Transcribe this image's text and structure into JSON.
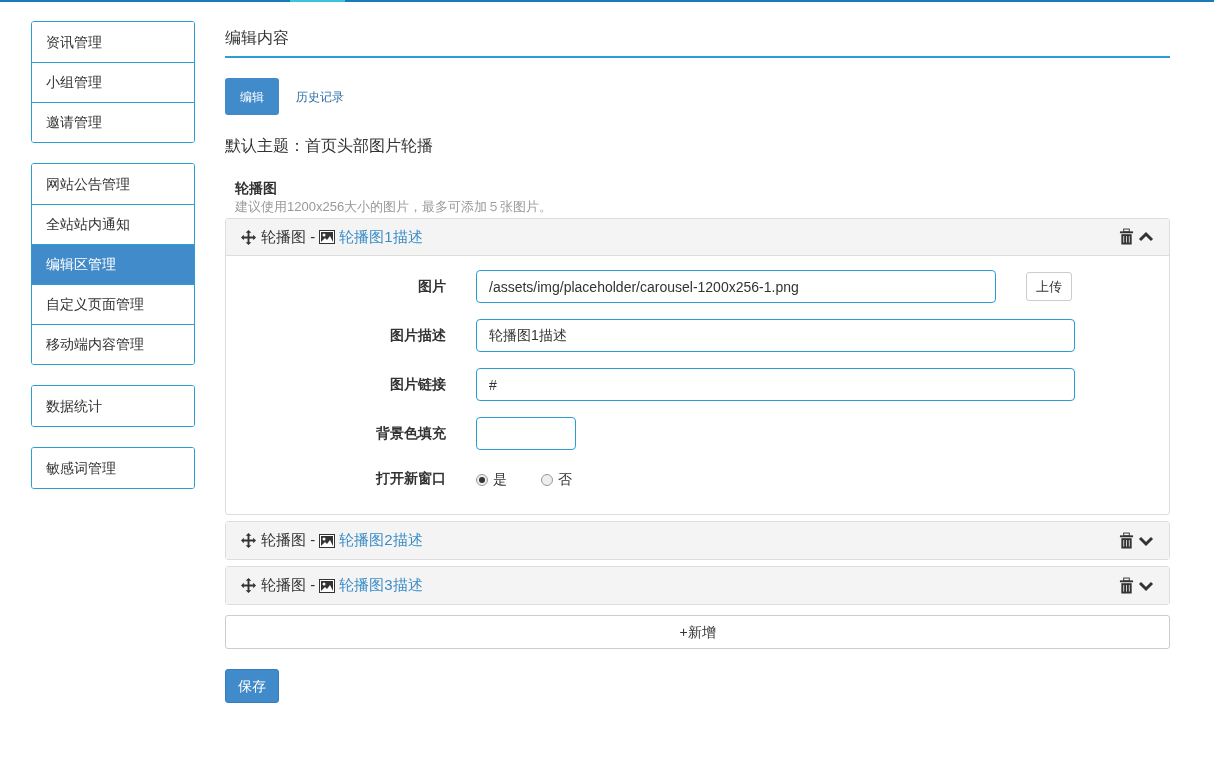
{
  "sidebar": {
    "groups": [
      [
        {
          "label": "资讯管理",
          "selected": false
        },
        {
          "label": "小组管理",
          "selected": false
        },
        {
          "label": "邀请管理",
          "selected": false
        }
      ],
      [
        {
          "label": "网站公告管理",
          "selected": false
        },
        {
          "label": "全站站内通知",
          "selected": false
        },
        {
          "label": "编辑区管理",
          "selected": true
        },
        {
          "label": "自定义页面管理",
          "selected": false
        },
        {
          "label": "移动端内容管理",
          "selected": false
        }
      ],
      [
        {
          "label": "数据统计",
          "selected": false
        }
      ],
      [
        {
          "label": "敏感词管理",
          "selected": false
        }
      ]
    ]
  },
  "heading": "编辑内容",
  "tabs": [
    {
      "label": "编辑",
      "selected": true
    },
    {
      "label": "历史记录",
      "selected": false
    }
  ],
  "theme": "默认主题：首页头部图片轮播",
  "section": {
    "title": "轮播图",
    "hint": "建议使用1200x256大小的图片，最多可添加５张图片。"
  },
  "slides": [
    {
      "prefix": "轮播图 -",
      "title": "轮播图1描述",
      "expanded": true,
      "fields": [
        {
          "kind": "text",
          "label": "图片",
          "value": "/assets/img/placeholder/carousel-1200x256-1.png",
          "button": "上传"
        },
        {
          "kind": "text",
          "label": "图片描述",
          "value": "轮播图1描述"
        },
        {
          "kind": "text",
          "label": "图片链接",
          "value": "#"
        },
        {
          "kind": "color",
          "label": "背景色填充"
        },
        {
          "kind": "radio",
          "label": "打开新窗口",
          "options": [
            {
              "label": "是",
              "selected": true
            },
            {
              "label": "否",
              "selected": false
            }
          ]
        }
      ]
    },
    {
      "prefix": "轮播图 -",
      "title": "轮播图2描述",
      "expanded": false
    },
    {
      "prefix": "轮播图 -",
      "title": "轮播图3描述",
      "expanded": false
    }
  ],
  "add_button": "+新增",
  "save_button": "保存"
}
